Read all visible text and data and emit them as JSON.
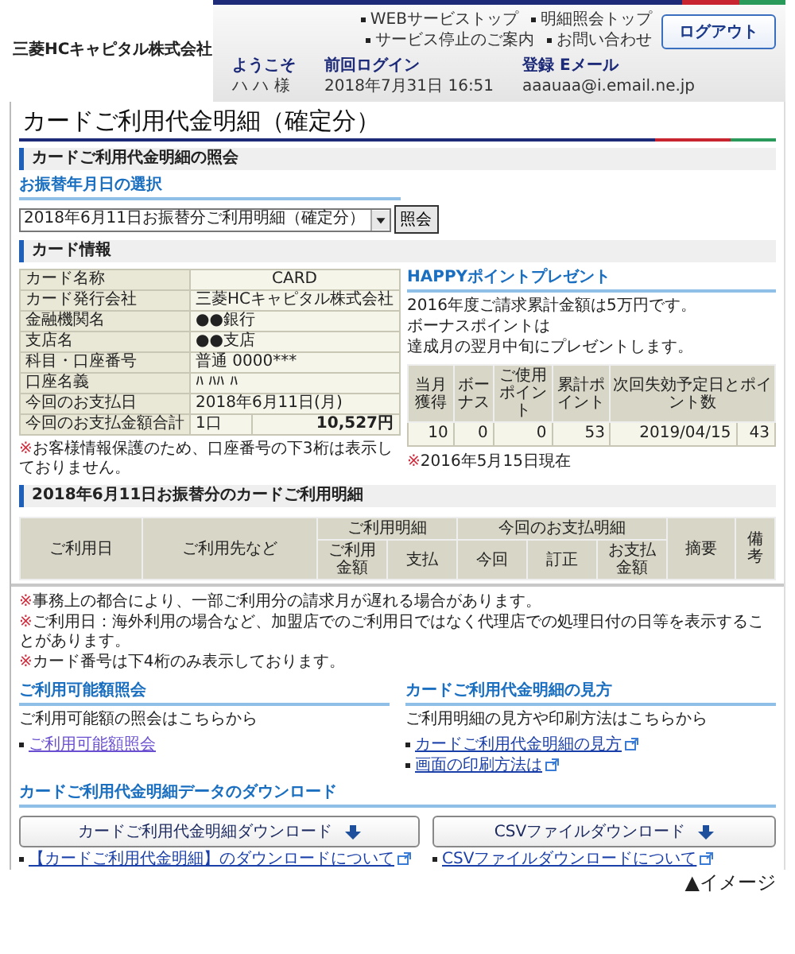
{
  "header": {
    "company": "三菱HCキャピタル株式会社",
    "nav": [
      "WEBサービストップ",
      "明細照会トップ",
      "サービス停止のご案内",
      "お問い合わせ"
    ],
    "logout": "ログアウト",
    "info": [
      {
        "label": "ようこそ",
        "value": "ハ ハ 様"
      },
      {
        "label": "前回ログイン",
        "value": "2018年7月31日 16:51"
      },
      {
        "label": "登録 Eメール",
        "value": "aaauaa@i.email.ne.jp"
      }
    ]
  },
  "page_title": "カードご利用代金明細（確定分）",
  "inquiry": {
    "heading": "カードご利用代金明細の照会",
    "subheading": "お振替年月日の選択",
    "select": "2018年6月11日お振替分ご利用明細（確定分）",
    "button": "照会"
  },
  "card_info": {
    "heading": "カード情報",
    "rows": [
      {
        "label": "カード名称",
        "value": "CARD"
      },
      {
        "label": "カード発行会社",
        "value": "三菱HCキャピタル株式会社"
      },
      {
        "label": "金融機関名",
        "value": "●●銀行"
      },
      {
        "label": "支店名",
        "value": "●●支店"
      },
      {
        "label": "科目・口座番号",
        "value": "普通 0000***"
      },
      {
        "label": "口座名義",
        "value": "ﾊ ﾊﾊ ﾊ"
      },
      {
        "label": "今回のお支払日",
        "value": "2018年6月11日(月)"
      },
      {
        "label": "今回のお支払金額合計",
        "value": "1口",
        "amount": "10,527円"
      }
    ],
    "note": {
      "mark": "※",
      "text": "お客様情報保護のため、口座番号の下3桁は表示しておりません。"
    }
  },
  "points": {
    "heading": "HAPPYポイントプレゼント",
    "lines": [
      "2016年度ご請求累計金額は5万円です。",
      "ボーナスポイントは",
      "達成月の翌月中旬にプレゼントします。"
    ],
    "columns": [
      "当月獲得",
      "ボーナス",
      "ご使用ポイント",
      "累計ポイント",
      "次回失効予定日とポイント数"
    ],
    "row": [
      "10",
      "0",
      "0",
      "53",
      "2019/04/15",
      "43"
    ],
    "note": {
      "mark": "※",
      "text": "2016年5月15日現在"
    }
  },
  "statement": {
    "heading": "2018年6月11日お振替分のカードご利用明細",
    "columns": [
      {
        "label": "ご利用日"
      },
      {
        "label": "ご利用先など"
      },
      {
        "label": "ご利用明細",
        "children": [
          {
            "label": "ご利用金額"
          },
          {
            "label": "支払"
          }
        ]
      },
      {
        "label": "今回のお支払明細",
        "children": [
          {
            "label": "今回"
          },
          {
            "label": "訂正"
          },
          {
            "label": "お支払金額"
          }
        ]
      },
      {
        "label": "摘要"
      },
      {
        "label": "備考"
      }
    ]
  },
  "notes": [
    {
      "mark": "※",
      "text": "事務上の都合により、一部ご利用分の請求月が遅れる場合があります。"
    },
    {
      "mark": "※",
      "text": "ご利用日：海外利用の場合など、加盟店でのご利用日ではなく代理店での処理日付の日等を表示することがあります。"
    },
    {
      "mark": "※",
      "text": "カード番号は下4桁のみ表示しております。"
    }
  ],
  "links": [
    {
      "heading": "ご利用可能額照会",
      "text": "ご利用可能額の照会はこちらから",
      "items": [
        {
          "label": "ご利用可能額照会",
          "external": false,
          "visited": true
        }
      ]
    },
    {
      "heading": "カードご利用代金明細の見方",
      "text": "ご利用明細の見方や印刷方法はこちらから",
      "items": [
        {
          "label": "カードご利用代金明細の見方",
          "external": true,
          "visited": false
        },
        {
          "label": "画面の印刷方法は",
          "external": true,
          "visited": false
        }
      ]
    }
  ],
  "download": {
    "heading": "カードご利用代金明細データのダウンロード",
    "items": [
      {
        "button": "カードご利用代金明細ダウンロード",
        "link": {
          "label": "【カードご利用代金明細】のダウンロードについて",
          "external": true,
          "visited": false
        }
      },
      {
        "button": "CSVファイルダウンロード",
        "link": {
          "label": "CSVファイルダウンロードについて",
          "external": true,
          "visited": false
        }
      }
    ]
  },
  "caption": "▲イメージ"
}
